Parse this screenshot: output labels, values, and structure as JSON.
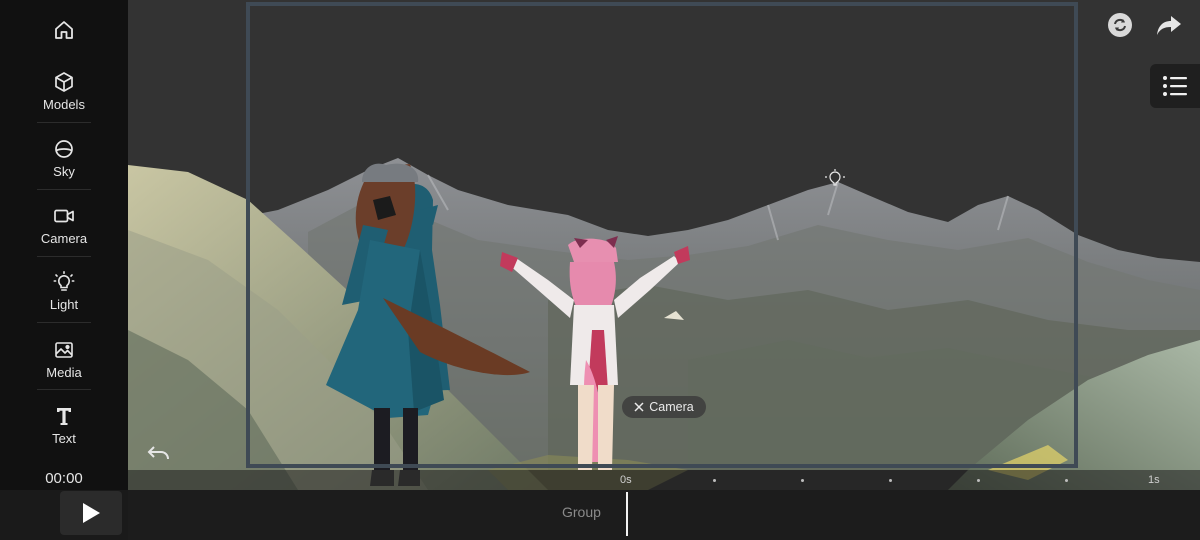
{
  "sidebar": {
    "items": [
      {
        "label": ""
      },
      {
        "label": "Models"
      },
      {
        "label": "Sky"
      },
      {
        "label": "Camera"
      },
      {
        "label": "Light"
      },
      {
        "label": "Media"
      },
      {
        "label": "Text"
      }
    ],
    "timecode": "00:00"
  },
  "viewport": {
    "camera_chip": "Camera"
  },
  "timeline": {
    "start_label": "0s",
    "end_label": "1s",
    "group_label": "Group"
  },
  "icons": {
    "home": "home-icon",
    "models": "cube-icon",
    "sky": "sky-sphere-icon",
    "camera": "video-camera-icon",
    "light": "light-bulb-icon",
    "media": "image-icon",
    "text": "text-t-icon",
    "refresh": "refresh-icon",
    "share": "share-icon",
    "list": "list-icon",
    "undo": "undo-icon",
    "play": "play-icon"
  },
  "colors": {
    "sidebar_bg": "#111111",
    "viewport_bg": "#333333",
    "frame": "#3f4a55",
    "accent": "#f2f2f2"
  }
}
